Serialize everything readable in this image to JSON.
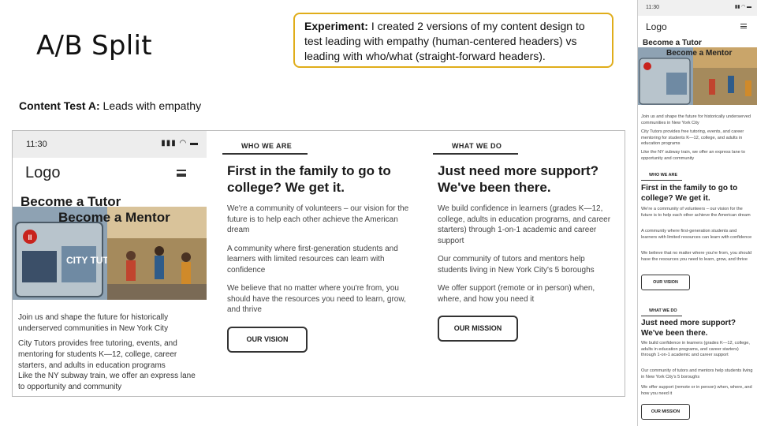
{
  "slide": {
    "title": "A/B Split",
    "experiment_lead": "Experiment:",
    "experiment_text": "I created 2 versions of my content design to test leading with empathy (human-centered headers) vs leading with who/what (straight-forward headers).",
    "test_label_lead": "Content Test A:",
    "test_label_text": "Leads with empathy",
    "accent_color": "#e0ad1a"
  },
  "phone": {
    "time": "11:30",
    "logo": "Logo",
    "hero_line1": "Become a Tutor",
    "hero_line2": "Become a Mentor",
    "hero_image_text": "CITY TUTORS",
    "intro": "Join us and shape the future for historically underserved communities in New York City",
    "desc": "City Tutors provides free tutoring, events, and mentoring for students K—12, college, career starters, and adults in education programs",
    "subway": "Like the NY subway train, we offer an express lane to opportunity and community"
  },
  "who": {
    "eyebrow": "WHO WE ARE",
    "heading": "First in the family to go to college? We get it.",
    "p1": "We're a community of volunteers – our vision for the future is to help each other achieve the American dream",
    "p2": "A community where first-generation students and learners with limited resources can learn with confidence",
    "p3": "We believe that no matter where you're from, you should have the resources you need to learn, grow, and thrive",
    "button": "OUR VISION"
  },
  "what": {
    "eyebrow": "WHAT WE DO",
    "heading": "Just need more support? We've been there.",
    "p1": "We build confidence in learners (grades K—12, college, adults in education programs, and career starters) through 1-on-1 academic and career support",
    "p2": "Our community of tutors and mentors help students living in New York City's 5 boroughs",
    "p3": "We offer support (remote or in person) when, where, and how you need it",
    "button": "OUR MISSION"
  },
  "rphone": {
    "time": "11:30",
    "logo": "Logo",
    "hero_line1": "Become a Tutor",
    "hero_line2": "Become a Mentor",
    "intro": "Join us and shape the future for historically underserved communities in New York City",
    "desc": "City Tutors provides free tutoring, events, and career mentoring for students K—12, college, and adults in education programs",
    "subway": "Like the NY subway train, we offer an express lane to opportunity and community",
    "who_eyebrow": "WHO WE ARE",
    "who_heading": "First in the family to go to college? We get it.",
    "who_p1": "We're a community of volunteers – our vision for the future is to help each other achieve the American dream",
    "who_p2": "A community where first-generation students and learners with limited resources can learn with confidence",
    "who_p3": "We believe that no matter where you're from, you should have the resources you need to learn, grow, and thrive",
    "who_button": "OUR VISION",
    "what_eyebrow": "WHAT WE DO",
    "what_heading": "Just need more support? We've been there.",
    "what_p1": "We build confidence in learners (grades K—12, college, adults in education programs, and career starters) through 1-on-1 academic and career support",
    "what_p2": "Our community of tutors and mentors help students living in New York City's 5 boroughs",
    "what_p3": "We offer support (remote or in person) when, where, and how you need it",
    "what_button": "OUR MISSION"
  }
}
